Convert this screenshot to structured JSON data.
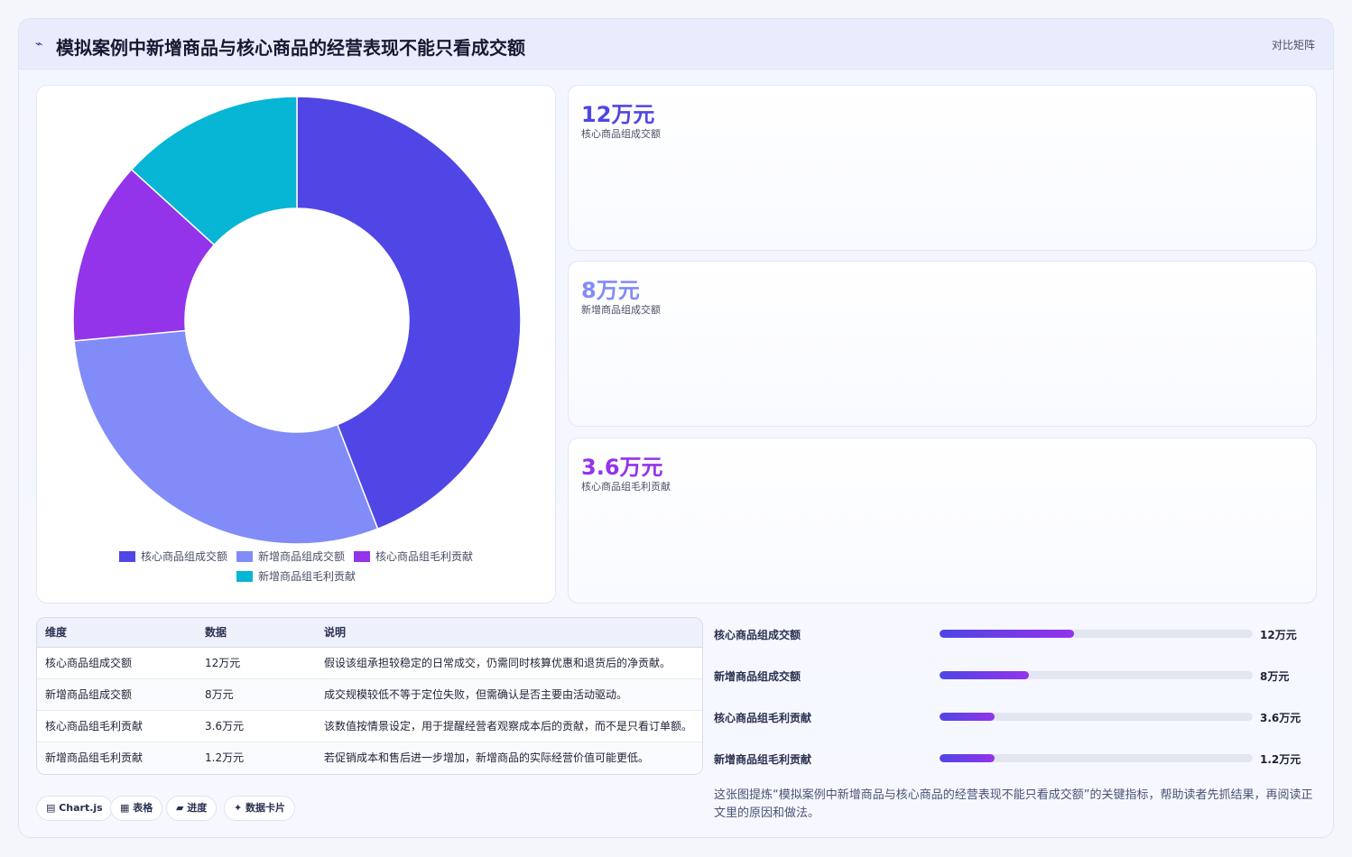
{
  "header": {
    "icon": "chart-line-icon",
    "title": "模拟案例中新增商品与核心商品的经营表现不能只看成交额",
    "badge": "对比矩阵"
  },
  "chart_data": {
    "type": "pie",
    "donut": true,
    "categories": [
      "核心商品组成交额",
      "新增商品组成交额",
      "核心商品组毛利贡献",
      "新增商品组毛利贡献"
    ],
    "values": [
      12,
      8,
      3.6,
      3.6
    ],
    "colors": [
      "#4f46e5",
      "#818cf8",
      "#9333ea",
      "#06b6d4"
    ],
    "legend_position": "bottom"
  },
  "kpis": [
    {
      "value": "12万元",
      "label": "核心商品组成交额",
      "color": "#4f46e5"
    },
    {
      "value": "8万元",
      "label": "新增商品组成交额",
      "color": "#818cf8"
    },
    {
      "value": "3.6万元",
      "label": "核心商品组毛利贡献",
      "color": "#9333ea"
    }
  ],
  "table": {
    "headers": [
      "维度",
      "数据",
      "说明"
    ],
    "rows": [
      [
        "核心商品组成交额",
        "12万元",
        "假设该组承担较稳定的日常成交，仍需同时核算优惠和退货后的净贡献。"
      ],
      [
        "新增商品组成交额",
        "8万元",
        "成交规模较低不等于定位失败，但需确认是否主要由活动驱动。"
      ],
      [
        "核心商品组毛利贡献",
        "3.6万元",
        "该数值按情景设定，用于提醒经营者观察成本后的贡献，而不是只看订单额。"
      ],
      [
        "新增商品组毛利贡献",
        "1.2万元",
        "若促销成本和售后进一步增加，新增商品的实际经营价值可能更低。"
      ]
    ]
  },
  "progress": [
    {
      "label": "核心商品组成交额",
      "value": "12万元",
      "fraction": 0.43
    },
    {
      "label": "新增商品组成交额",
      "value": "8万元",
      "fraction": 0.285
    },
    {
      "label": "核心商品组毛利贡献",
      "value": "3.6万元",
      "fraction": 0.175
    },
    {
      "label": "新增商品组毛利贡献",
      "value": "1.2万元",
      "fraction": 0.175
    }
  ],
  "note": "这张图提炼“模拟案例中新增商品与核心商品的经营表现不能只看成交额”的关键指标，帮助读者先抓结果，再阅读正文里的原因和做法。",
  "tags": [
    {
      "icon": "chart-icon",
      "label": "▤ Chart.js"
    },
    {
      "icon": "table-icon",
      "label": "▦ 表格"
    },
    {
      "icon": "progress-icon",
      "label": "▰ 进度"
    },
    {
      "icon": "card-icon",
      "label": "✦ 数据卡片"
    }
  ]
}
